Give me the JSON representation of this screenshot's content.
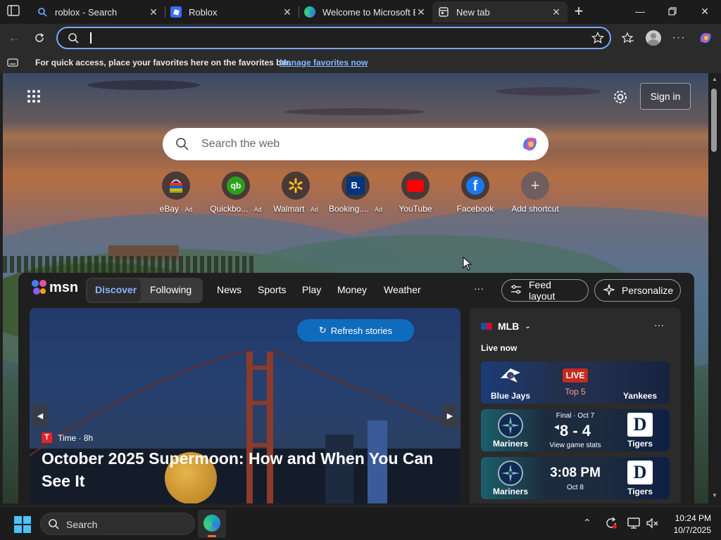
{
  "tabs": [
    {
      "title": "roblox - Search"
    },
    {
      "title": "Roblox"
    },
    {
      "title": "Welcome to Microsoft E"
    },
    {
      "title": "New tab"
    }
  ],
  "favorites_bar": {
    "message": "For quick access, place your favorites here on the favorites bar.",
    "link": "Manage favorites now"
  },
  "page": {
    "sign_in": "Sign in",
    "search_placeholder": "Search the web"
  },
  "shortcuts": [
    {
      "label": "eBay",
      "ad": "· Ad",
      "icon": "ebay-icon"
    },
    {
      "label": "Quickbo...",
      "ad": "· Ad",
      "icon": "quickbooks-icon"
    },
    {
      "label": "Walmart",
      "ad": "· Ad",
      "icon": "walmart-icon"
    },
    {
      "label": "Booking....",
      "ad": "· Ad",
      "icon": "booking-icon"
    },
    {
      "label": "YouTube",
      "ad": "",
      "icon": "youtube-icon"
    },
    {
      "label": "Facebook",
      "ad": "",
      "icon": "facebook-icon"
    },
    {
      "label": "Add shortcut",
      "ad": "",
      "icon": "plus-icon"
    }
  ],
  "msn": {
    "logo_text": "msn",
    "discover": "Discover",
    "following": "Following",
    "nav": [
      "News",
      "Sports",
      "Play",
      "Money",
      "Weather"
    ],
    "more": "···",
    "feed_layout": "Feed layout",
    "personalize": "Personalize"
  },
  "hero": {
    "refresh": "Refresh stories",
    "source_badge": "T",
    "source": "Time · 8h",
    "headline": "October 2025 Supermoon: How and When You Can See It"
  },
  "mlb": {
    "title": "MLB",
    "live_now": "Live now",
    "more": "···",
    "games": [
      {
        "left": "Blue Jays",
        "right": "Yankees",
        "status": "LIVE",
        "detail": "Top 5"
      },
      {
        "left": "Mariners",
        "right": "Tigers",
        "status": "Final · Oct 7",
        "score": "8 - 4",
        "detail": "View game stats"
      },
      {
        "left": "Mariners",
        "right": "Tigers",
        "status": "3:08 PM",
        "detail": "Oct 8"
      }
    ]
  },
  "taskbar": {
    "search": "Search",
    "time": "10:24 PM",
    "date": "10/7/2025"
  },
  "colors": {
    "accent_blue": "#0f6cbd",
    "address_border": "#7aa7ff",
    "live_red": "#c42b1c"
  }
}
